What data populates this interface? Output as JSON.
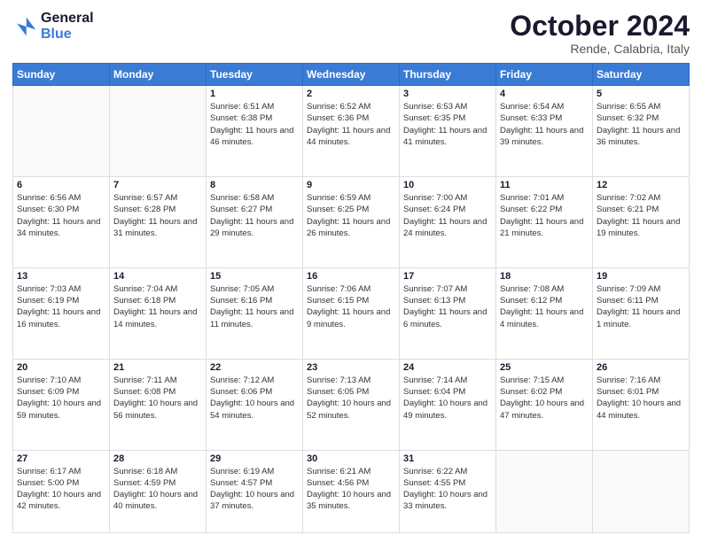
{
  "header": {
    "logo_line1": "General",
    "logo_line2": "Blue",
    "month": "October 2024",
    "location": "Rende, Calabria, Italy"
  },
  "weekdays": [
    "Sunday",
    "Monday",
    "Tuesday",
    "Wednesday",
    "Thursday",
    "Friday",
    "Saturday"
  ],
  "weeks": [
    [
      {
        "day": "",
        "info": ""
      },
      {
        "day": "",
        "info": ""
      },
      {
        "day": "1",
        "info": "Sunrise: 6:51 AM\nSunset: 6:38 PM\nDaylight: 11 hours and 46 minutes."
      },
      {
        "day": "2",
        "info": "Sunrise: 6:52 AM\nSunset: 6:36 PM\nDaylight: 11 hours and 44 minutes."
      },
      {
        "day": "3",
        "info": "Sunrise: 6:53 AM\nSunset: 6:35 PM\nDaylight: 11 hours and 41 minutes."
      },
      {
        "day": "4",
        "info": "Sunrise: 6:54 AM\nSunset: 6:33 PM\nDaylight: 11 hours and 39 minutes."
      },
      {
        "day": "5",
        "info": "Sunrise: 6:55 AM\nSunset: 6:32 PM\nDaylight: 11 hours and 36 minutes."
      }
    ],
    [
      {
        "day": "6",
        "info": "Sunrise: 6:56 AM\nSunset: 6:30 PM\nDaylight: 11 hours and 34 minutes."
      },
      {
        "day": "7",
        "info": "Sunrise: 6:57 AM\nSunset: 6:28 PM\nDaylight: 11 hours and 31 minutes."
      },
      {
        "day": "8",
        "info": "Sunrise: 6:58 AM\nSunset: 6:27 PM\nDaylight: 11 hours and 29 minutes."
      },
      {
        "day": "9",
        "info": "Sunrise: 6:59 AM\nSunset: 6:25 PM\nDaylight: 11 hours and 26 minutes."
      },
      {
        "day": "10",
        "info": "Sunrise: 7:00 AM\nSunset: 6:24 PM\nDaylight: 11 hours and 24 minutes."
      },
      {
        "day": "11",
        "info": "Sunrise: 7:01 AM\nSunset: 6:22 PM\nDaylight: 11 hours and 21 minutes."
      },
      {
        "day": "12",
        "info": "Sunrise: 7:02 AM\nSunset: 6:21 PM\nDaylight: 11 hours and 19 minutes."
      }
    ],
    [
      {
        "day": "13",
        "info": "Sunrise: 7:03 AM\nSunset: 6:19 PM\nDaylight: 11 hours and 16 minutes."
      },
      {
        "day": "14",
        "info": "Sunrise: 7:04 AM\nSunset: 6:18 PM\nDaylight: 11 hours and 14 minutes."
      },
      {
        "day": "15",
        "info": "Sunrise: 7:05 AM\nSunset: 6:16 PM\nDaylight: 11 hours and 11 minutes."
      },
      {
        "day": "16",
        "info": "Sunrise: 7:06 AM\nSunset: 6:15 PM\nDaylight: 11 hours and 9 minutes."
      },
      {
        "day": "17",
        "info": "Sunrise: 7:07 AM\nSunset: 6:13 PM\nDaylight: 11 hours and 6 minutes."
      },
      {
        "day": "18",
        "info": "Sunrise: 7:08 AM\nSunset: 6:12 PM\nDaylight: 11 hours and 4 minutes."
      },
      {
        "day": "19",
        "info": "Sunrise: 7:09 AM\nSunset: 6:11 PM\nDaylight: 11 hours and 1 minute."
      }
    ],
    [
      {
        "day": "20",
        "info": "Sunrise: 7:10 AM\nSunset: 6:09 PM\nDaylight: 10 hours and 59 minutes."
      },
      {
        "day": "21",
        "info": "Sunrise: 7:11 AM\nSunset: 6:08 PM\nDaylight: 10 hours and 56 minutes."
      },
      {
        "day": "22",
        "info": "Sunrise: 7:12 AM\nSunset: 6:06 PM\nDaylight: 10 hours and 54 minutes."
      },
      {
        "day": "23",
        "info": "Sunrise: 7:13 AM\nSunset: 6:05 PM\nDaylight: 10 hours and 52 minutes."
      },
      {
        "day": "24",
        "info": "Sunrise: 7:14 AM\nSunset: 6:04 PM\nDaylight: 10 hours and 49 minutes."
      },
      {
        "day": "25",
        "info": "Sunrise: 7:15 AM\nSunset: 6:02 PM\nDaylight: 10 hours and 47 minutes."
      },
      {
        "day": "26",
        "info": "Sunrise: 7:16 AM\nSunset: 6:01 PM\nDaylight: 10 hours and 44 minutes."
      }
    ],
    [
      {
        "day": "27",
        "info": "Sunrise: 6:17 AM\nSunset: 5:00 PM\nDaylight: 10 hours and 42 minutes."
      },
      {
        "day": "28",
        "info": "Sunrise: 6:18 AM\nSunset: 4:59 PM\nDaylight: 10 hours and 40 minutes."
      },
      {
        "day": "29",
        "info": "Sunrise: 6:19 AM\nSunset: 4:57 PM\nDaylight: 10 hours and 37 minutes."
      },
      {
        "day": "30",
        "info": "Sunrise: 6:21 AM\nSunset: 4:56 PM\nDaylight: 10 hours and 35 minutes."
      },
      {
        "day": "31",
        "info": "Sunrise: 6:22 AM\nSunset: 4:55 PM\nDaylight: 10 hours and 33 minutes."
      },
      {
        "day": "",
        "info": ""
      },
      {
        "day": "",
        "info": ""
      }
    ]
  ]
}
